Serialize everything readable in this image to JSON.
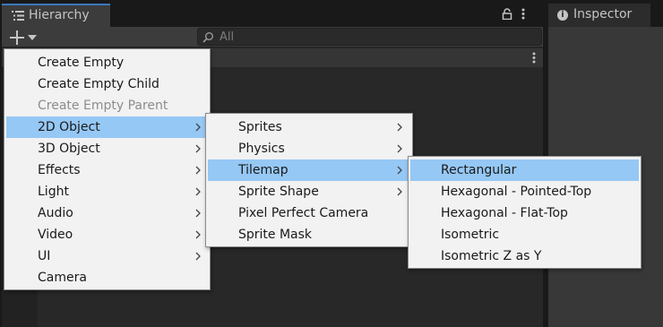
{
  "hierarchy": {
    "tab_label": "Hierarchy",
    "search_placeholder": "All"
  },
  "inspector": {
    "tab_label": "Inspector"
  },
  "create_menu": {
    "items": [
      {
        "label": "Create Empty",
        "submenu": false,
        "disabled": false
      },
      {
        "label": "Create Empty Child",
        "submenu": false,
        "disabled": false
      },
      {
        "label": "Create Empty Parent",
        "submenu": false,
        "disabled": true
      },
      {
        "label": "2D Object",
        "submenu": true,
        "disabled": false,
        "active": true
      },
      {
        "label": "3D Object",
        "submenu": true,
        "disabled": false
      },
      {
        "label": "Effects",
        "submenu": true,
        "disabled": false
      },
      {
        "label": "Light",
        "submenu": true,
        "disabled": false
      },
      {
        "label": "Audio",
        "submenu": true,
        "disabled": false
      },
      {
        "label": "Video",
        "submenu": true,
        "disabled": false
      },
      {
        "label": "UI",
        "submenu": true,
        "disabled": false
      },
      {
        "label": "Camera",
        "submenu": false,
        "disabled": false
      }
    ]
  },
  "object_2d_menu": {
    "items": [
      {
        "label": "Sprites",
        "submenu": true
      },
      {
        "label": "Physics",
        "submenu": true
      },
      {
        "label": "Tilemap",
        "submenu": true,
        "active": true
      },
      {
        "label": "Sprite Shape",
        "submenu": true
      },
      {
        "label": "Pixel Perfect Camera",
        "submenu": false
      },
      {
        "label": "Sprite Mask",
        "submenu": false
      }
    ]
  },
  "tilemap_menu": {
    "items": [
      {
        "label": "Rectangular",
        "active": true
      },
      {
        "label": "Hexagonal - Pointed-Top"
      },
      {
        "label": "Hexagonal - Flat-Top"
      },
      {
        "label": "Isometric"
      },
      {
        "label": "Isometric Z as Y"
      }
    ]
  },
  "colors": {
    "highlight": "#96c8f5",
    "menu_bg": "#f2f2f2",
    "panel_bg": "#282828",
    "tab_accent": "#3a79bb"
  }
}
